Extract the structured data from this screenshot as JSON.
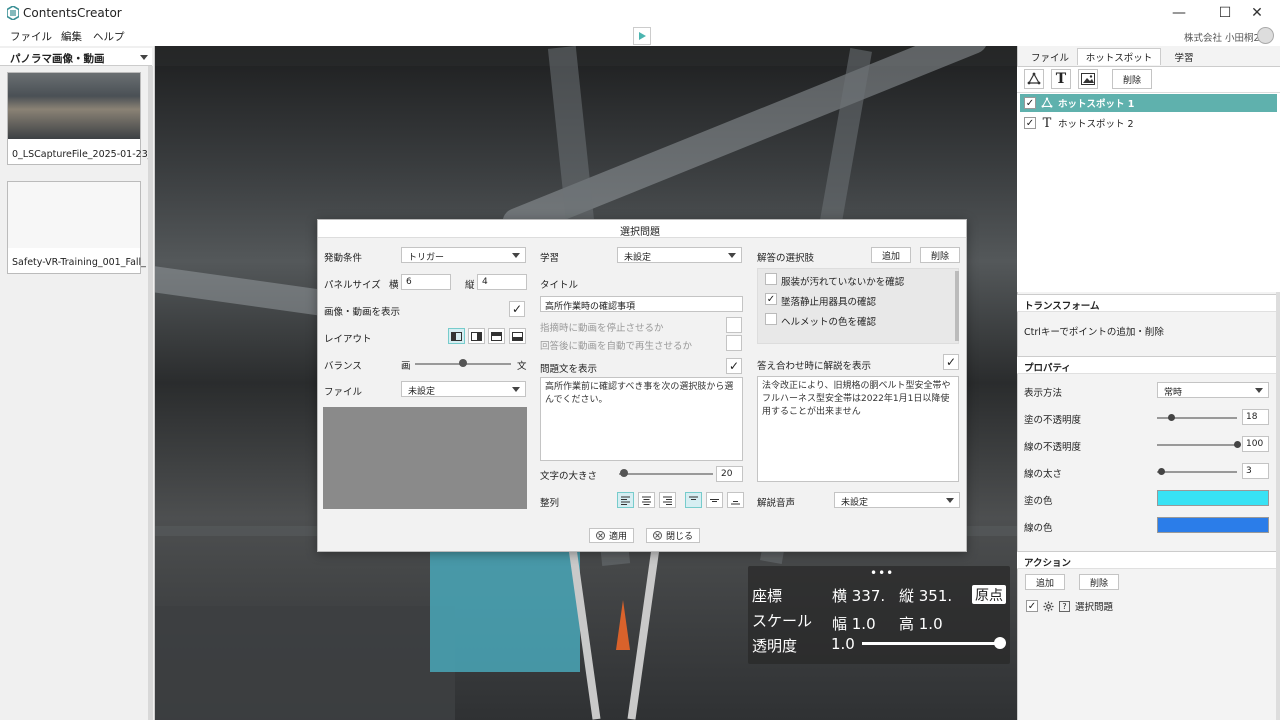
{
  "window": {
    "app_title": "ContentsCreator",
    "minimize_glyph": "—",
    "maximize_glyph": "☐",
    "close_glyph": "✕"
  },
  "menu": {
    "items": [
      "ファイル",
      "編集",
      "ヘルプ"
    ],
    "company": "株式会社",
    "user": "小田桐2"
  },
  "left_panel": {
    "header": "パノラマ画像・動画",
    "thumbnails": [
      {
        "label": "0_LSCaptureFile_2025-01-23_"
      },
      {
        "label": "Safety-VR-Training_001_Fall_"
      }
    ]
  },
  "overlay": {
    "coord_label": "座標",
    "x_text": "横 337.",
    "y_text": "縦 351.",
    "origin_button": "原点",
    "scale_label": "スケール",
    "width_text": "幅 1.0",
    "height_text": "高 1.0",
    "opacity_label": "透明度",
    "opacity_value": "1.0",
    "opacity_level": 1.0
  },
  "dialog": {
    "title": "選択問題",
    "trigger_label": "発動条件",
    "trigger_value": "トリガー",
    "panel_size_label": "パネルサイズ",
    "width_label": "横",
    "width_value": "6",
    "height_label": "縦",
    "height_value": "4",
    "show_media_label": "画像・動画を表示",
    "layout_label": "レイアウト",
    "balance_label": "バランス",
    "balance_left": "画",
    "balance_right": "文",
    "balance_level": 0.5,
    "file_label": "ファイル",
    "file_value": "未設定",
    "learning_label": "学習",
    "learning_value": "未設定",
    "title_label": "タイトル",
    "title_value": "高所作業時の確認事項",
    "pause_label": "指摘時に動画を停止させるか",
    "autoplay_label": "回答後に動画を自動で再生させるか",
    "show_question_label": "問題文を表示",
    "question_text": "高所作業前に確認すべき事を次の選択肢から選んでください。",
    "font_size_label": "文字の大きさ",
    "font_size_value": "20",
    "font_size_level": 0.05,
    "align_label": "整列",
    "choices_label": "解答の選択肢",
    "add_button": "追加",
    "delete_button": "削除",
    "choices": [
      {
        "text": "服装が汚れていないかを確認",
        "checked": false
      },
      {
        "text": "墜落静止用器具の確認",
        "checked": true
      },
      {
        "text": "ヘルメットの色を確認",
        "checked": false
      }
    ],
    "show_explanation_label": "答え合わせ時に解説を表示",
    "explanation_text": "法令改正により、旧規格の胴ベルト型安全帯やフルハーネス型安全帯は2022年1月1日以降使用することが出来ません",
    "audio_label": "解説音声",
    "audio_value": "未設定",
    "apply_button": "適用",
    "close_button": "閉じる",
    "check_glyph": "✓"
  },
  "right_panel": {
    "tabs": [
      "ファイル",
      "ホットスポット",
      "学習"
    ],
    "delete_button": "削除",
    "hotspots": [
      {
        "label": "ホットスポット 1",
        "icon": "polygon-icon"
      },
      {
        "label": "ホットスポット 2",
        "icon": "text-icon"
      }
    ],
    "transform_header": "トランスフォーム",
    "transform_hint": "Ctrlキーでポイントの追加・削除",
    "properties_header": "プロパティ",
    "display_method_label": "表示方法",
    "display_method_value": "常時",
    "fill_opacity_label": "塗の不透明度",
    "fill_opacity_value": "18",
    "fill_opacity_level": 0.18,
    "line_opacity_label": "線の不透明度",
    "line_opacity_value": "100",
    "line_opacity_level": 1.0,
    "line_width_label": "線の太さ",
    "line_width_value": "3",
    "line_width_level": 0.05,
    "fill_color_label": "塗の色",
    "fill_color": "#38e2f4",
    "line_color_label": "線の色",
    "line_color": "#2b7de9",
    "actions_header": "アクション",
    "action_add": "追加",
    "action_delete": "削除",
    "action_item": "選択問題"
  },
  "colors": {
    "accent": "#5fb1ad",
    "play": "#4bb5b0"
  }
}
